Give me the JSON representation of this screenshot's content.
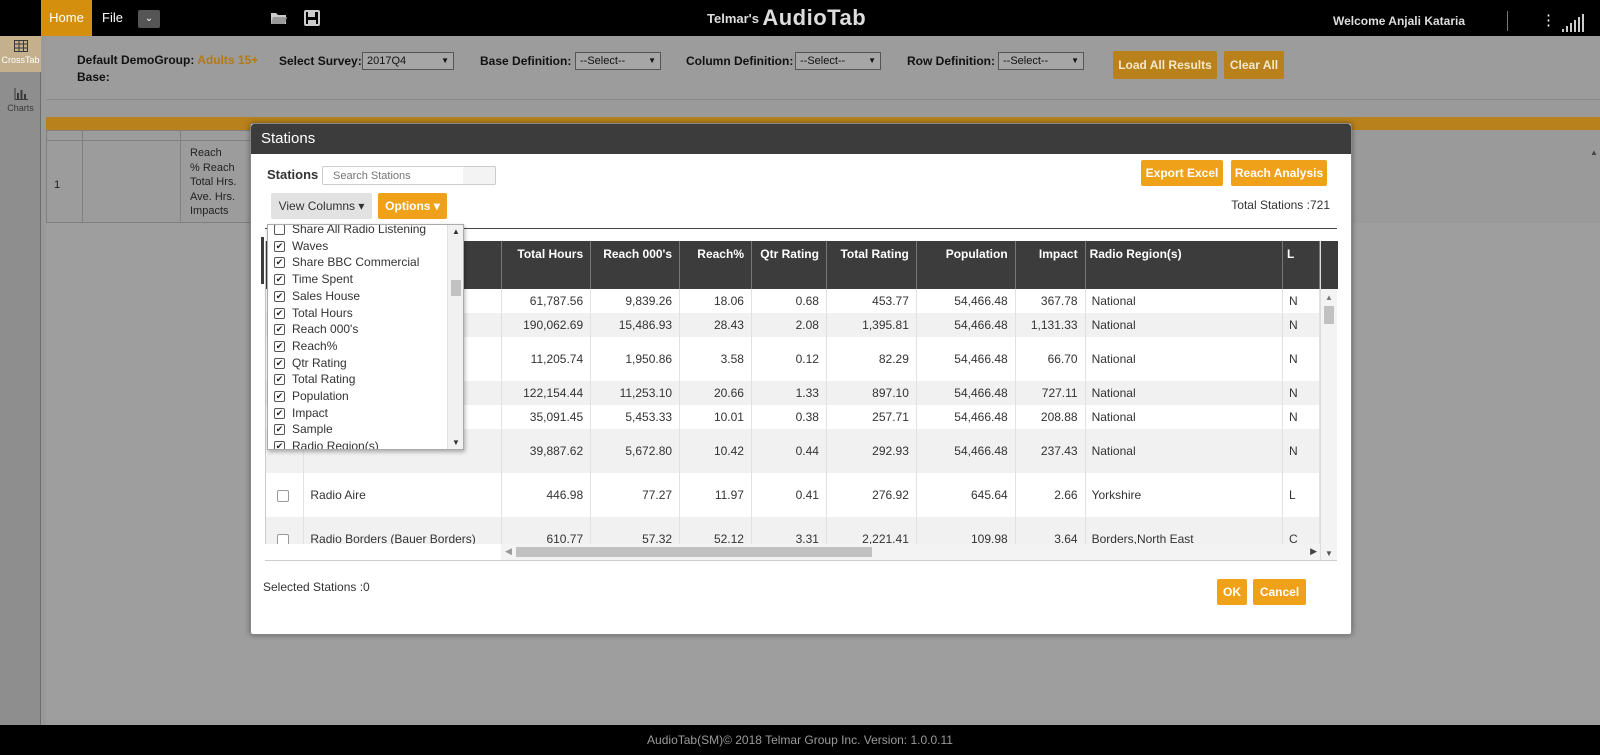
{
  "topbar": {
    "home_label": "Home",
    "file_label": "File",
    "dropdown_glyph": "⌄",
    "brand_prefix": "Telmar's",
    "brand_name": "AudioTab",
    "welcome": "Welcome Anjali Kataria"
  },
  "sidebar": {
    "items": [
      {
        "label": "CrossTab",
        "icon": "grid-icon"
      },
      {
        "label": "Charts",
        "icon": "bar-chart-icon"
      }
    ]
  },
  "criteria": {
    "demogroup_label": "Default DemoGroup:",
    "demogroup_value": "Adults 15+",
    "base_label": "Base:",
    "survey_label": "Select Survey:",
    "survey_value": "2017Q4",
    "base_def_label": "Base Definition:",
    "base_def_value": "--Select--",
    "col_def_label": "Column Definition:",
    "col_def_value": "--Select--",
    "row_def_label": "Row Definition:",
    "row_def_value": "--Select--",
    "load_all": "Load All Results",
    "clear_all": "Clear All"
  },
  "background_grid": {
    "row_number": "1",
    "measures": [
      "Reach",
      "% Reach",
      "Total Hrs.",
      "Ave. Hrs.",
      "Impacts"
    ]
  },
  "modal": {
    "title": "Stations",
    "stations_label": "Stations",
    "search_placeholder": "Search Stations",
    "export_excel": "Export Excel",
    "reach_analysis": "Reach Analysis",
    "total_stations": "Total Stations :721",
    "view_columns": "View Columns ▾",
    "options": "Options ▾",
    "selected_stations": "Selected Stations :0",
    "ok": "OK",
    "cancel": "Cancel"
  },
  "view_columns_list": [
    {
      "label": "Share All Radio Listening",
      "checked": false
    },
    {
      "label": "Waves",
      "checked": true
    },
    {
      "label": "Share BBC Commercial",
      "checked": true
    },
    {
      "label": "Time Spent",
      "checked": true
    },
    {
      "label": "Sales House",
      "checked": true
    },
    {
      "label": "Total Hours",
      "checked": true
    },
    {
      "label": "Reach 000's",
      "checked": true
    },
    {
      "label": "Reach%",
      "checked": true
    },
    {
      "label": "Qtr Rating",
      "checked": true
    },
    {
      "label": "Total Rating",
      "checked": true
    },
    {
      "label": "Population",
      "checked": true
    },
    {
      "label": "Impact",
      "checked": true
    },
    {
      "label": "Sample",
      "checked": true
    },
    {
      "label": "Radio Region(s)",
      "checked": true
    }
  ],
  "table": {
    "headers": [
      "Total Hours",
      "Reach 000's",
      "Reach%",
      "Qtr Rating",
      "Total Rating",
      "Population",
      "Impact",
      "Radio Region(s)",
      "L"
    ],
    "rows": [
      {
        "name": "",
        "cells": [
          "61,787.56",
          "9,839.26",
          "18.06",
          "0.68",
          "453.77",
          "54,466.48",
          "367.78",
          "National",
          "N"
        ]
      },
      {
        "name": "",
        "cells": [
          "190,062.69",
          "15,486.93",
          "28.43",
          "2.08",
          "1,395.81",
          "54,466.48",
          "1,131.33",
          "National",
          "N"
        ]
      },
      {
        "name": "",
        "cells": [
          "11,205.74",
          "1,950.86",
          "3.58",
          "0.12",
          "82.29",
          "54,466.48",
          "66.70",
          "National",
          "N"
        ]
      },
      {
        "name": "",
        "cells": [
          "122,154.44",
          "11,253.10",
          "20.66",
          "1.33",
          "897.10",
          "54,466.48",
          "727.11",
          "National",
          "N"
        ]
      },
      {
        "name": "",
        "cells": [
          "35,091.45",
          "5,453.33",
          "10.01",
          "0.38",
          "257.71",
          "54,466.48",
          "208.88",
          "National",
          "N"
        ]
      },
      {
        "name": "",
        "cells": [
          "39,887.62",
          "5,672.80",
          "10.42",
          "0.44",
          "292.93",
          "54,466.48",
          "237.43",
          "National",
          "N"
        ]
      },
      {
        "name": "Radio Aire",
        "cells": [
          "446.98",
          "77.27",
          "11.97",
          "0.41",
          "276.92",
          "645.64",
          "2.66",
          "Yorkshire",
          "L"
        ]
      },
      {
        "name": "Radio Borders (Bauer Borders)",
        "cells": [
          "610.77",
          "57.32",
          "52.12",
          "3.31",
          "2,221.41",
          "109.98",
          "3.64",
          "Borders,North East",
          "C"
        ]
      }
    ]
  },
  "footer": "AudioTab(SM)© 2018 Telmar Group Inc. Version: 1.0.0.11",
  "colors": {
    "accent": "#f0a11a",
    "header_dark": "#3c3c3c",
    "dim_accent": "#d48f0f"
  }
}
